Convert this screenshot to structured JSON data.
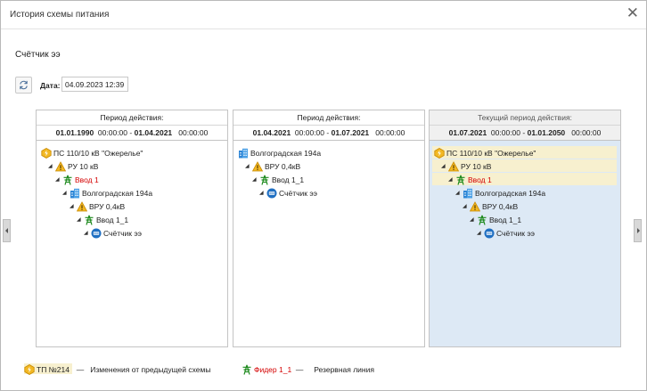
{
  "window": {
    "title": "История схемы питания"
  },
  "header": {
    "object_name": "Счётчик ээ"
  },
  "toolbar": {
    "date_label": "Дата:",
    "date_value": "04.09.2023 12:39"
  },
  "colors": {
    "changed_highlight": "#f7f0cf",
    "current_panel_bg": "#dde9f5",
    "red_text": "#d40000"
  },
  "periods": [
    {
      "heading": "Период действия:",
      "start_date": "01.01.1990",
      "start_time": "00:00:00",
      "dash": "-",
      "end_date": "01.04.2021",
      "end_time": "00:00:00",
      "tree": [
        {
          "label": "ПС 110/10 кВ \"Ожерелье\"",
          "icon": "substation-icon",
          "level": 0,
          "toggle": ""
        },
        {
          "label": "РУ 10 кВ",
          "icon": "warning-triangle-icon",
          "level": 1,
          "toggle": "◢"
        },
        {
          "label": "Ввод 1",
          "icon": "pylon-icon",
          "level": 2,
          "toggle": "◢",
          "red": true
        },
        {
          "label": "Волгоградская 194а",
          "icon": "building-icon",
          "level": 3,
          "toggle": "◢"
        },
        {
          "label": "ВРУ 0,4кВ",
          "icon": "warning-triangle-icon",
          "level": 4,
          "toggle": "◢"
        },
        {
          "label": "Ввод 1_1",
          "icon": "pylon-icon",
          "level": 5,
          "toggle": "◢"
        },
        {
          "label": "Счётчик ээ",
          "icon": "meter-icon",
          "level": 6,
          "toggle": "◢"
        }
      ]
    },
    {
      "heading": "Период действия:",
      "start_date": "01.04.2021",
      "start_time": "00:00:00",
      "dash": "-",
      "end_date": "01.07.2021",
      "end_time": "00:00:00",
      "tree": [
        {
          "label": "Волгоградская 194а",
          "icon": "building-icon",
          "level": 0,
          "toggle": ""
        },
        {
          "label": "ВРУ 0,4кВ",
          "icon": "warning-triangle-icon",
          "level": 1,
          "toggle": "◢"
        },
        {
          "label": "Ввод 1_1",
          "icon": "pylon-icon",
          "level": 2,
          "toggle": "◢"
        },
        {
          "label": "Счётчик ээ",
          "icon": "meter-icon",
          "level": 3,
          "toggle": "◢"
        }
      ]
    },
    {
      "heading": "Текущий период действия:",
      "start_date": "01.07.2021",
      "start_time": "00:00:00",
      "dash": "-",
      "end_date": "01.01.2050",
      "end_time": "00:00:00",
      "tree": [
        {
          "label": "ПС 110/10 кВ \"Ожерелье\"",
          "icon": "substation-icon",
          "level": 0,
          "toggle": "",
          "changed": true
        },
        {
          "label": "РУ 10 кВ",
          "icon": "warning-triangle-icon",
          "level": 1,
          "toggle": "◢",
          "changed": true
        },
        {
          "label": "Ввод 1",
          "icon": "pylon-icon",
          "level": 2,
          "toggle": "◢",
          "red": true,
          "changed": true
        },
        {
          "label": "Волгоградская 194а",
          "icon": "building-icon",
          "level": 3,
          "toggle": "◢"
        },
        {
          "label": "ВРУ 0,4кВ",
          "icon": "warning-triangle-icon",
          "level": 4,
          "toggle": "◢"
        },
        {
          "label": "Ввод 1_1",
          "icon": "pylon-icon",
          "level": 5,
          "toggle": "◢"
        },
        {
          "label": "Счётчик ээ",
          "icon": "meter-icon",
          "level": 6,
          "toggle": "◢"
        }
      ]
    }
  ],
  "legend": {
    "changed_example": "ТП №214",
    "changed_dash": "—",
    "changed_text": "Изменения от предыдущей схемы",
    "reserve_example": "Фидер 1_1",
    "reserve_dash": "—",
    "reserve_text": "Резервная линия"
  }
}
